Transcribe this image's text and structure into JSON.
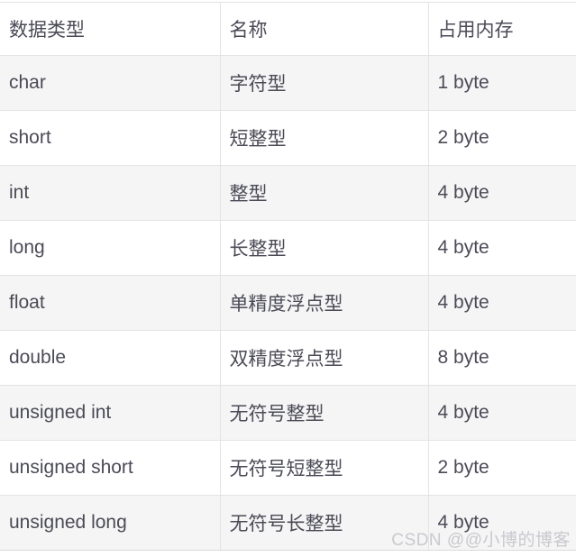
{
  "table": {
    "columns": [
      "数据类型",
      "名称",
      "占用内存"
    ],
    "rows": [
      {
        "type": "char",
        "name": "字符型",
        "size": "1 byte"
      },
      {
        "type": "short",
        "name": "短整型",
        "size": "2 byte"
      },
      {
        "type": "int",
        "name": "整型",
        "size": "4 byte"
      },
      {
        "type": "long",
        "name": "长整型",
        "size": "4 byte"
      },
      {
        "type": "float",
        "name": "单精度浮点型",
        "size": "4 byte"
      },
      {
        "type": "double",
        "name": "双精度浮点型",
        "size": "8 byte"
      },
      {
        "type": "unsigned int",
        "name": "无符号整型",
        "size": "4 byte"
      },
      {
        "type": "unsigned short",
        "name": "无符号短整型",
        "size": "2 byte"
      },
      {
        "type": "unsigned long",
        "name": "无符号长整型",
        "size": "4 byte"
      }
    ]
  },
  "watermark": {
    "text": "CSDN @@小博的博客"
  },
  "colors": {
    "text": "#4b4b57",
    "border": "#e3e3e3",
    "row_alt_bg": "#f5f5f5",
    "row_bg": "#ffffff",
    "watermark": "#c9c9cf"
  }
}
